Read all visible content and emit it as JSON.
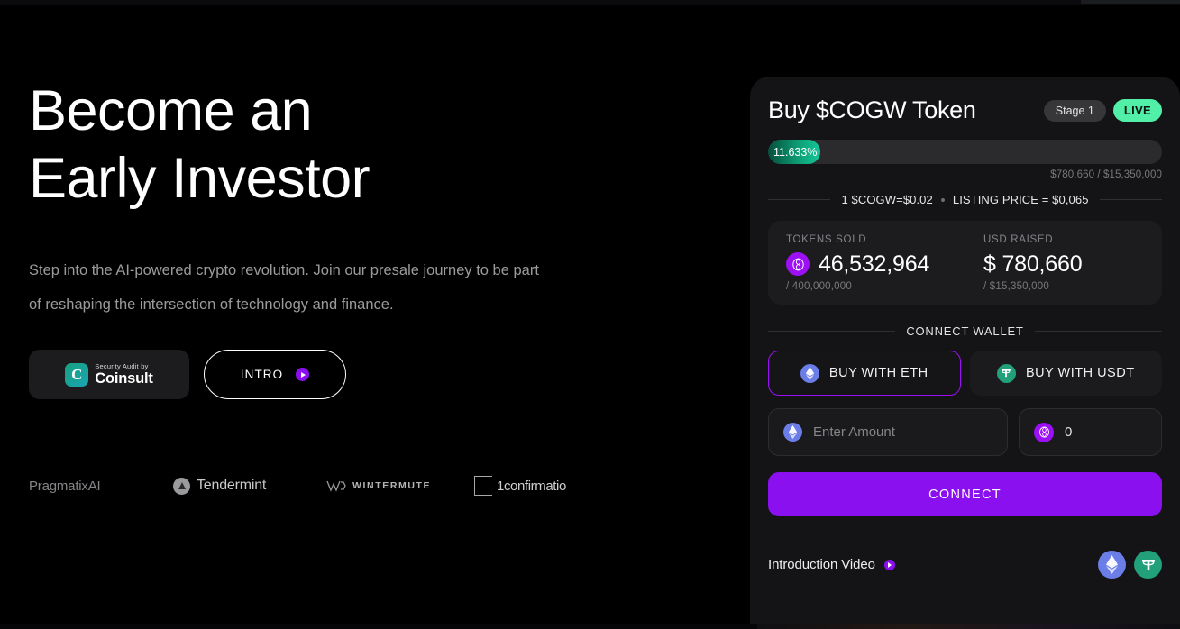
{
  "hero": {
    "headline_line1": "Become an",
    "headline_line2": "Early Investor",
    "subtext": "Step into the AI-powered crypto revolution. Join our presale journey to be part of reshaping the intersection of technology and finance.",
    "audit_badge": {
      "mark_letter": "C",
      "top_label": "Security Audit by",
      "name": "Coinsult"
    },
    "intro_button_label": "INTRO"
  },
  "partners": [
    {
      "name": "PragmatixAI",
      "icon": ""
    },
    {
      "name": "Tendermint",
      "icon": "tendermint-icon"
    },
    {
      "name": "WINTERMUTE",
      "icon": "wintermute-icon"
    },
    {
      "name": "1confirmatio",
      "icon": "confirmation-icon"
    }
  ],
  "presale": {
    "title": "Buy $COGW Token",
    "stage_badge": "Stage 1",
    "live_badge": "LIVE",
    "progress_percent_label": "11.633%",
    "progress_percent_value": 11.633,
    "progress_sub": "$780,660 / $15,350,000",
    "price_current": "1 $COGW=$0.02",
    "price_listing": "LISTING PRICE = $0,065",
    "stats": [
      {
        "label": "TOKENS SOLD",
        "icon": "cogw-token-icon",
        "value": "46,532,964",
        "sub": "/ 400,000,000"
      },
      {
        "label": "USD RAISED",
        "icon": "",
        "value": "$ 780,660",
        "sub": "/ $15,350,000"
      }
    ],
    "connect_wallet_title": "CONNECT WALLET",
    "pay_tabs": [
      {
        "label": "BUY WITH ETH",
        "icon": "eth-icon",
        "active": true
      },
      {
        "label": "BUY WITH USDT",
        "icon": "usdt-icon",
        "active": false
      }
    ],
    "amount_input": {
      "icon": "eth-icon",
      "placeholder": "Enter Amount",
      "value": ""
    },
    "receive_output": {
      "icon": "cogw-token-icon",
      "value": "0"
    },
    "connect_button_label": "CONNECT",
    "intro_video_label": "Introduction Video",
    "footer_icons": [
      "eth-icon",
      "usdt-icon"
    ]
  },
  "colors": {
    "accent_purple": "#8b10f0",
    "live_green": "#52efa9",
    "progress_green": "#16c79a",
    "eth_blue": "#6b7ee8",
    "usdt_green": "#22a079",
    "card_bg": "#141416",
    "page_bg": "#000000"
  }
}
